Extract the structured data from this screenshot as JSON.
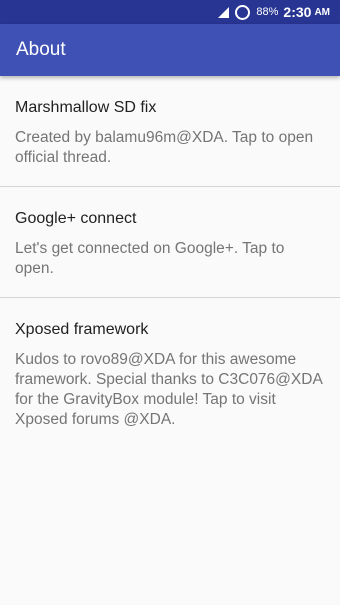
{
  "status_bar": {
    "battery": "88%",
    "time": "2:30",
    "ampm": "AM"
  },
  "app_bar": {
    "title": "About"
  },
  "items": [
    {
      "title": "Marshmallow SD fix",
      "summary": "Created by balamu96m@XDA. Tap to open official thread."
    },
    {
      "title": "Google+ connect",
      "summary": "Let's get connected on Google+. Tap to open."
    },
    {
      "title": "Xposed framework",
      "summary": "Kudos to rovo89@XDA for this awesome framework. Special thanks to C3C076@XDA for the GravityBox module! Tap to visit Xposed forums @XDA."
    }
  ],
  "colors": {
    "primary": "#3f51b5",
    "primary_dark": "#283593"
  }
}
